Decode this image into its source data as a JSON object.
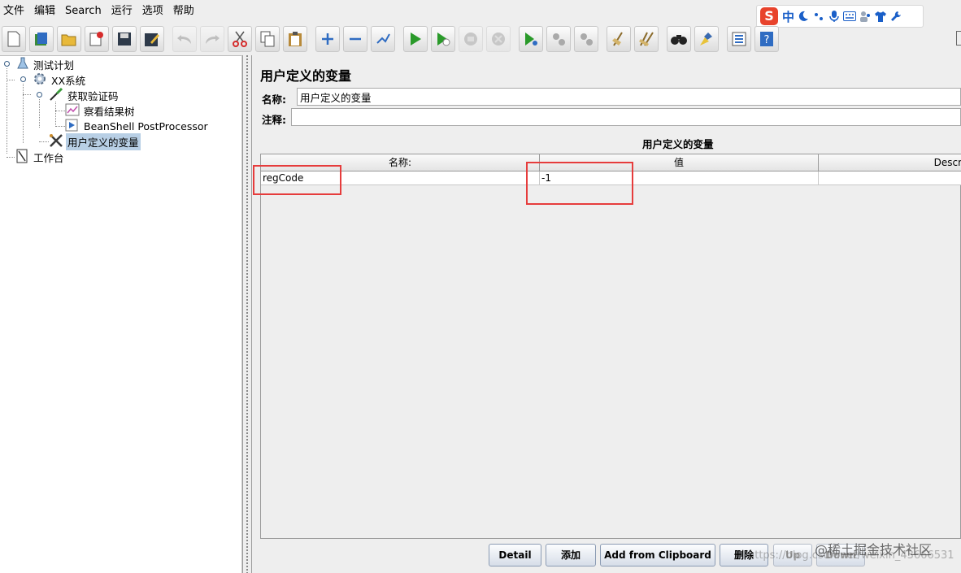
{
  "menu": [
    "文件",
    "编辑",
    "Search",
    "运行",
    "选项",
    "帮助"
  ],
  "ime": {
    "logo": "S",
    "lang": "中"
  },
  "toolbar": {
    "icons": [
      "new-icon",
      "templates-icon",
      "open-icon",
      "close-icon",
      "save-icon",
      "save-as-icon",
      "undo-icon",
      "redo-icon",
      "cut-icon",
      "copy-icon",
      "paste-icon",
      "expand-icon",
      "collapse-icon",
      "toggle-icon",
      "start-icon",
      "start-no-pause-icon",
      "stop-icon",
      "shutdown-icon",
      "remote-start-icon",
      "remote-stop-icon",
      "remote-exit-icon",
      "clear-icon",
      "clear-all-icon",
      "search-icon",
      "reset-search-icon",
      "function-helper-icon",
      "help-icon"
    ]
  },
  "tree": {
    "test_plan": "测试计划",
    "thread_group": "XX系统",
    "sampler": "获取验证码",
    "listener": "察看结果树",
    "postprocessor": "BeanShell PostProcessor",
    "config": "用户定义的变量",
    "workbench": "工作台"
  },
  "panel": {
    "title": "用户定义的变量",
    "name_label": "名称:",
    "name_value": "用户定义的变量",
    "comment_label": "注释:",
    "comment_value": "",
    "table_title": "用户定义的变量",
    "columns": [
      "名称:",
      "值",
      "Descr"
    ],
    "rows": [
      {
        "name": "regCode",
        "value": "-1",
        "desc": ""
      }
    ]
  },
  "buttons": {
    "detail": "Detail",
    "add": "添加",
    "add_clipboard": "Add from Clipboard",
    "delete": "删除",
    "up": "Up",
    "down": "Down"
  },
  "watermark": "https://blog.csdn.net/weixin_43666531",
  "brand": "@稀土掘金技术社区",
  "colors": {
    "highlight": "#e63c3c",
    "selection": "#b8cfe5"
  }
}
